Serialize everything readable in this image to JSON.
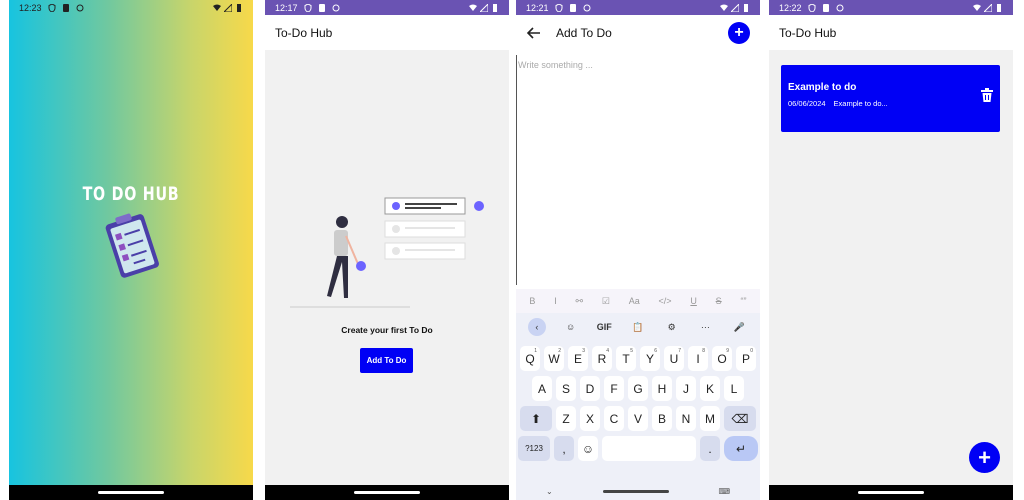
{
  "colors": {
    "primary": "#0000f5",
    "statusbar": "#6a53b3",
    "background": "#f1f1f1"
  },
  "screen1": {
    "status": {
      "time": "12:23"
    },
    "splash_title": "TO DO HUB"
  },
  "screen2": {
    "status": {
      "time": "12:17"
    },
    "app_title": "To-Do Hub",
    "empty_message": "Create your first To Do",
    "add_button": "Add To Do"
  },
  "screen3": {
    "status": {
      "time": "12:21"
    },
    "app_title": "Add To Do",
    "editor_placeholder": "Write something ...",
    "format_tools": [
      "B",
      "I",
      "⚯",
      "☑",
      "Aa",
      "</>",
      "U",
      "S",
      "“”"
    ],
    "keyboard": {
      "toolbar": [
        "‹",
        "☺",
        "GIF",
        "📋",
        "⚙",
        "···",
        "🎤"
      ],
      "row1": [
        "Q",
        "W",
        "E",
        "R",
        "T",
        "Y",
        "U",
        "I",
        "O",
        "P"
      ],
      "row1_hints": [
        "1",
        "2",
        "3",
        "4",
        "5",
        "6",
        "7",
        "8",
        "9",
        "0"
      ],
      "row2": [
        "A",
        "S",
        "D",
        "F",
        "G",
        "H",
        "J",
        "K",
        "L"
      ],
      "row3": [
        "Z",
        "X",
        "C",
        "V",
        "B",
        "N",
        "M"
      ],
      "symbols_key": "?123",
      "comma_key": ",",
      "emoji_key": "☺",
      "period_key": ".",
      "shift_key": "⬆",
      "backspace_key": "⌫",
      "enter_key": "↵",
      "hide_key": "⌄",
      "layout_key": "⌨"
    }
  },
  "screen4": {
    "status": {
      "time": "12:22"
    },
    "app_title": "To-Do Hub",
    "todos": [
      {
        "title": "Example to do",
        "date": "06/06/2024",
        "preview": "Example to do..."
      }
    ]
  }
}
